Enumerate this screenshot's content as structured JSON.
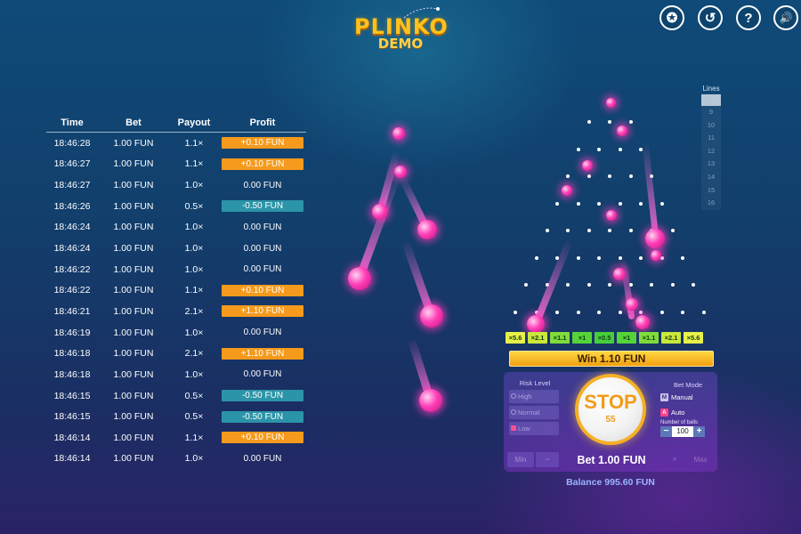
{
  "logo": {
    "word": "PLINKO",
    "sub": "DEMO"
  },
  "top_icons": [
    {
      "name": "trophy-icon",
      "glyph": "✪"
    },
    {
      "name": "history-icon",
      "glyph": "↺"
    },
    {
      "name": "help-icon",
      "glyph": "?"
    },
    {
      "name": "sound-icon",
      "glyph": "🔊"
    }
  ],
  "history": {
    "headers": {
      "time": "Time",
      "bet": "Bet",
      "payout": "Payout",
      "profit": "Profit"
    },
    "rows": [
      {
        "time": "18:46:28",
        "bet": "1.00 FUN",
        "payout": "1.1×",
        "profit": "+0.10 FUN",
        "kind": "pos"
      },
      {
        "time": "18:46:27",
        "bet": "1.00 FUN",
        "payout": "1.1×",
        "profit": "+0.10 FUN",
        "kind": "pos"
      },
      {
        "time": "18:46:27",
        "bet": "1.00 FUN",
        "payout": "1.0×",
        "profit": "0.00 FUN",
        "kind": "zero"
      },
      {
        "time": "18:46:26",
        "bet": "1.00 FUN",
        "payout": "0.5×",
        "profit": "-0.50 FUN",
        "kind": "neg"
      },
      {
        "time": "18:46:24",
        "bet": "1.00 FUN",
        "payout": "1.0×",
        "profit": "0.00 FUN",
        "kind": "zero"
      },
      {
        "time": "18:46:24",
        "bet": "1.00 FUN",
        "payout": "1.0×",
        "profit": "0.00 FUN",
        "kind": "zero"
      },
      {
        "time": "18:46:22",
        "bet": "1.00 FUN",
        "payout": "1.0×",
        "profit": "0.00 FUN",
        "kind": "zero"
      },
      {
        "time": "18:46:22",
        "bet": "1.00 FUN",
        "payout": "1.1×",
        "profit": "+0.10 FUN",
        "kind": "pos"
      },
      {
        "time": "18:46:21",
        "bet": "1.00 FUN",
        "payout": "2.1×",
        "profit": "+1.10 FUN",
        "kind": "pos"
      },
      {
        "time": "18:46:19",
        "bet": "1.00 FUN",
        "payout": "1.0×",
        "profit": "0.00 FUN",
        "kind": "zero"
      },
      {
        "time": "18:46:18",
        "bet": "1.00 FUN",
        "payout": "2.1×",
        "profit": "+1.10 FUN",
        "kind": "pos"
      },
      {
        "time": "18:46:18",
        "bet": "1.00 FUN",
        "payout": "1.0×",
        "profit": "0.00 FUN",
        "kind": "zero"
      },
      {
        "time": "18:46:15",
        "bet": "1.00 FUN",
        "payout": "0.5×",
        "profit": "-0.50 FUN",
        "kind": "neg"
      },
      {
        "time": "18:46:15",
        "bet": "1.00 FUN",
        "payout": "0.5×",
        "profit": "-0.50 FUN",
        "kind": "neg"
      },
      {
        "time": "18:46:14",
        "bet": "1.00 FUN",
        "payout": "1.1×",
        "profit": "+0.10 FUN",
        "kind": "pos"
      },
      {
        "time": "18:46:14",
        "bet": "1.00 FUN",
        "payout": "1.0×",
        "profit": "0.00 FUN",
        "kind": "zero"
      }
    ]
  },
  "lines": {
    "title": "Lines",
    "selected": "8",
    "options": [
      "9",
      "10",
      "11",
      "12",
      "13",
      "14",
      "15",
      "16"
    ]
  },
  "multipliers": [
    {
      "label": "×5.6",
      "color": "#e8f04a"
    },
    {
      "label": "×2.1",
      "color": "#c9e83a"
    },
    {
      "label": "×1.1",
      "color": "#7fdc3a"
    },
    {
      "label": "×1",
      "color": "#55d43a"
    },
    {
      "label": "×0.5",
      "color": "#45cf3a"
    },
    {
      "label": "×1",
      "color": "#55d43a"
    },
    {
      "label": "×1.1",
      "color": "#7fdc3a"
    },
    {
      "label": "×2.1",
      "color": "#c9e83a"
    },
    {
      "label": "×5.6",
      "color": "#e8f04a"
    }
  ],
  "win_banner": "Win 1.10 FUN",
  "risk": {
    "title": "Risk Level",
    "options": [
      {
        "label": "High",
        "selected": false
      },
      {
        "label": "Normal",
        "selected": false
      },
      {
        "label": "Low",
        "selected": true
      }
    ]
  },
  "stop": {
    "label": "STOP",
    "count": "55"
  },
  "bet_mode": {
    "title": "Bet Mode",
    "manual": {
      "key": "M",
      "label": "Manual"
    },
    "auto": {
      "key": "A",
      "label": "Auto"
    },
    "number_label": "Number of balls",
    "number_value": "100",
    "minus": "−",
    "plus": "+"
  },
  "bet": {
    "min": "Min",
    "minus": "−",
    "plus": "+",
    "max": "Max",
    "label": "Bet 1.00 FUN"
  },
  "balance": "Balance 995.60 FUN",
  "colors": {
    "profit_pos": "#f59a1c",
    "profit_neg": "#2c94a8",
    "accent": "#ffc21a",
    "ball": "#ff3fb8"
  }
}
